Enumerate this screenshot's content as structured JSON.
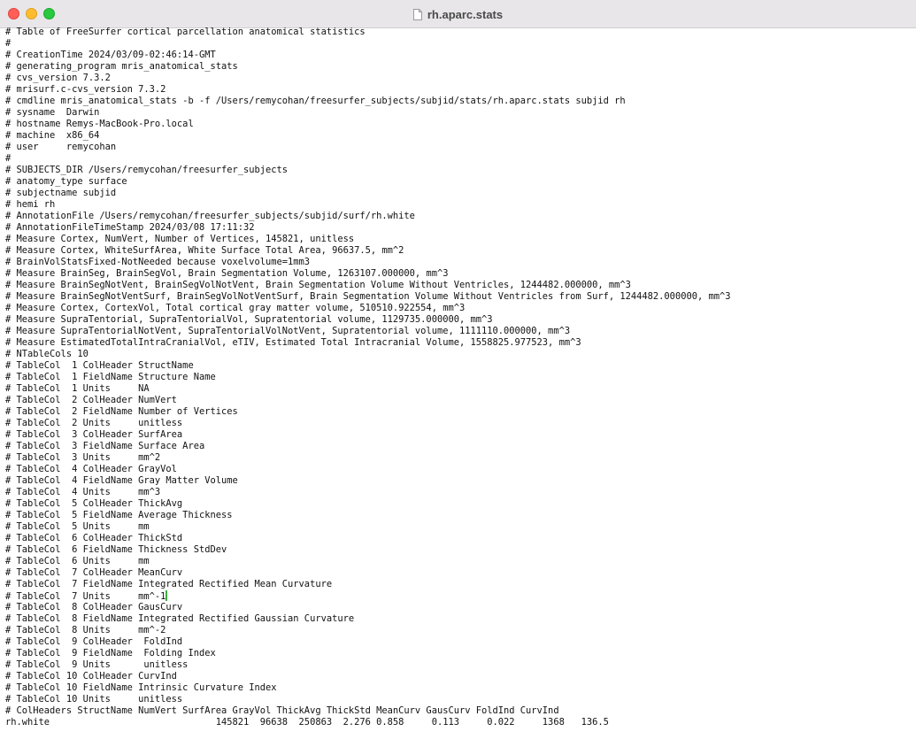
{
  "window": {
    "title": "rh.aparc.stats",
    "colors": {
      "titlebar": "#e8e6e8",
      "close": "#ff5f57",
      "minimize": "#febc2e",
      "maximize": "#28c840",
      "cursor": "#3fae3f"
    },
    "icons": [
      "close-icon",
      "minimize-icon",
      "maximize-icon",
      "document-icon"
    ]
  },
  "editor": {
    "cursor_line": 49,
    "lines": [
      "# Table of FreeSurfer cortical parcellation anatomical statistics",
      "#",
      "# CreationTime 2024/03/09-02:46:14-GMT",
      "# generating_program mris_anatomical_stats",
      "# cvs_version 7.3.2",
      "# mrisurf.c-cvs_version 7.3.2",
      "# cmdline mris_anatomical_stats -b -f /Users/remycohan/freesurfer_subjects/subjid/stats/rh.aparc.stats subjid rh",
      "# sysname  Darwin",
      "# hostname Remys-MacBook-Pro.local",
      "# machine  x86_64",
      "# user     remycohan",
      "#",
      "# SUBJECTS_DIR /Users/remycohan/freesurfer_subjects",
      "# anatomy_type surface",
      "# subjectname subjid",
      "# hemi rh",
      "# AnnotationFile /Users/remycohan/freesurfer_subjects/subjid/surf/rh.white",
      "# AnnotationFileTimeStamp 2024/03/08 17:11:32",
      "# Measure Cortex, NumVert, Number of Vertices, 145821, unitless",
      "# Measure Cortex, WhiteSurfArea, White Surface Total Area, 96637.5, mm^2",
      "# BrainVolStatsFixed-NotNeeded because voxelvolume=1mm3",
      "# Measure BrainSeg, BrainSegVol, Brain Segmentation Volume, 1263107.000000, mm^3",
      "# Measure BrainSegNotVent, BrainSegVolNotVent, Brain Segmentation Volume Without Ventricles, 1244482.000000, mm^3",
      "# Measure BrainSegNotVentSurf, BrainSegVolNotVentSurf, Brain Segmentation Volume Without Ventricles from Surf, 1244482.000000, mm^3",
      "# Measure Cortex, CortexVol, Total cortical gray matter volume, 510510.922554, mm^3",
      "# Measure SupraTentorial, SupraTentorialVol, Supratentorial volume, 1129735.000000, mm^3",
      "# Measure SupraTentorialNotVent, SupraTentorialVolNotVent, Supratentorial volume, 1111110.000000, mm^3",
      "# Measure EstimatedTotalIntraCranialVol, eTIV, Estimated Total Intracranial Volume, 1558825.977523, mm^3",
      "# NTableCols 10",
      "# TableCol  1 ColHeader StructName",
      "# TableCol  1 FieldName Structure Name",
      "# TableCol  1 Units     NA",
      "# TableCol  2 ColHeader NumVert",
      "# TableCol  2 FieldName Number of Vertices",
      "# TableCol  2 Units     unitless",
      "# TableCol  3 ColHeader SurfArea",
      "# TableCol  3 FieldName Surface Area",
      "# TableCol  3 Units     mm^2",
      "# TableCol  4 ColHeader GrayVol",
      "# TableCol  4 FieldName Gray Matter Volume",
      "# TableCol  4 Units     mm^3",
      "# TableCol  5 ColHeader ThickAvg",
      "# TableCol  5 FieldName Average Thickness",
      "# TableCol  5 Units     mm",
      "# TableCol  6 ColHeader ThickStd",
      "# TableCol  6 FieldName Thickness StdDev",
      "# TableCol  6 Units     mm",
      "# TableCol  7 ColHeader MeanCurv",
      "# TableCol  7 FieldName Integrated Rectified Mean Curvature",
      "# TableCol  7 Units     mm^-1",
      "# TableCol  8 ColHeader GausCurv",
      "# TableCol  8 FieldName Integrated Rectified Gaussian Curvature",
      "# TableCol  8 Units     mm^-2",
      "# TableCol  9 ColHeader  FoldInd",
      "# TableCol  9 FieldName  Folding Index",
      "# TableCol  9 Units      unitless",
      "# TableCol 10 ColHeader CurvInd",
      "# TableCol 10 FieldName Intrinsic Curvature Index",
      "# TableCol 10 Units     unitless",
      "# ColHeaders StructName NumVert SurfArea GrayVol ThickAvg ThickStd MeanCurv GausCurv FoldInd CurvInd",
      "rh.white                              145821  96638  250863  2.276 0.858     0.113     0.022     1368   136.5"
    ]
  }
}
